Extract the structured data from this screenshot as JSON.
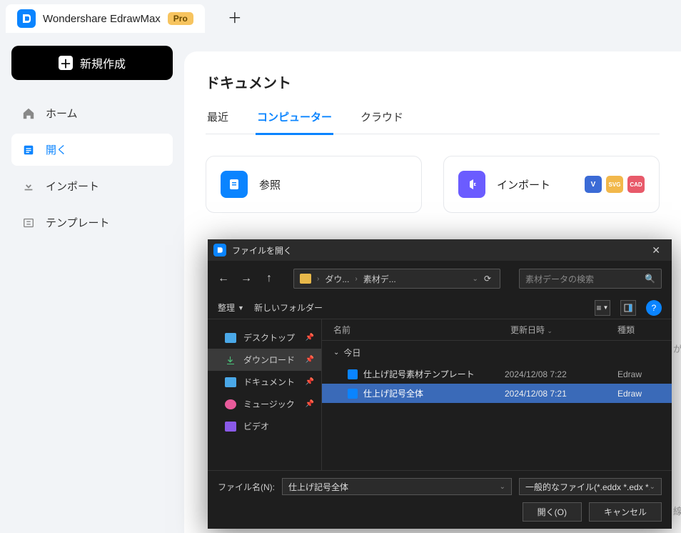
{
  "header": {
    "app_name": "Wondershare EdrawMax",
    "pro_badge": "Pro"
  },
  "sidebar": {
    "new_button": "新規作成",
    "items": [
      {
        "label": "ホーム",
        "icon": "home"
      },
      {
        "label": "開く",
        "icon": "open"
      },
      {
        "label": "インポート",
        "icon": "import"
      },
      {
        "label": "テンプレート",
        "icon": "template"
      }
    ]
  },
  "content": {
    "title": "ドキュメント",
    "tabs": [
      {
        "label": "最近"
      },
      {
        "label": "コンピューター"
      },
      {
        "label": "クラウド"
      }
    ],
    "cards": {
      "browse": {
        "label": "参照"
      },
      "import": {
        "label": "インポート"
      }
    },
    "badges": {
      "v": "V",
      "svg": "SVG",
      "cad": "CAD"
    }
  },
  "dialog": {
    "title": "ファイルを開く",
    "path": {
      "seg1": "ダウ...",
      "seg2": "素材デ..."
    },
    "search_placeholder": "素材データの検索",
    "toolbar": {
      "organize": "整理",
      "new_folder": "新しいフォルダー"
    },
    "columns": {
      "name": "名前",
      "date": "更新日時",
      "type": "種類"
    },
    "sidebar_items": [
      {
        "label": "デスクトップ",
        "color": "#4aa8e8"
      },
      {
        "label": "ダウンロード",
        "color": "#4ac078",
        "selected": true,
        "icon": "download"
      },
      {
        "label": "ドキュメント",
        "color": "#4aa8e8"
      },
      {
        "label": "ミュージック",
        "color": "#e85a9a"
      },
      {
        "label": "ビデオ",
        "color": "#8a5ae8"
      }
    ],
    "group": "今日",
    "files": [
      {
        "name": "仕上げ記号素材テンプレート",
        "date": "2024/12/08 7:22",
        "type": "Edraw"
      },
      {
        "name": "仕上げ記号全体",
        "date": "2024/12/08 7:21",
        "type": "Edraw",
        "selected": true
      }
    ],
    "filename_label": "ファイル名(N):",
    "filename_value": "仕上げ記号全体",
    "filetype": "一般的なファイル(*.eddx *.edx *.vs",
    "open_btn": "開く(O)",
    "cancel_btn": "キャンセル"
  },
  "partial": {
    "t1": "が",
    "t2": "線"
  }
}
